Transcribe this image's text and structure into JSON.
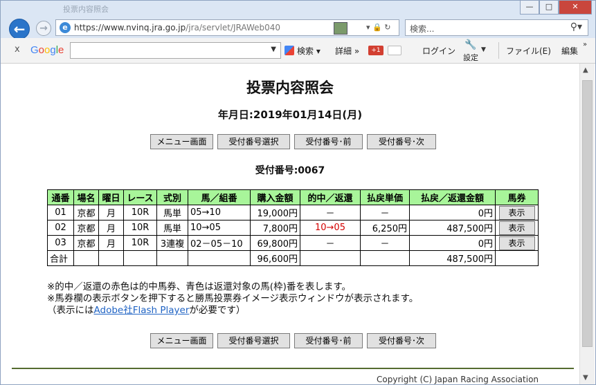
{
  "browser": {
    "title_faded": "投票内容照会",
    "url_prefix": "https://www.nvinq.jra.go.jp",
    "url_path": "/jra/servlet/JRAWeb040",
    "search_placeholder": "検索...",
    "window_controls": {
      "min": "—",
      "max": "□",
      "close": "✕"
    },
    "colors": {
      "chrome": "#dbe6f4",
      "back": "#2a74c9",
      "close": "#c9463d"
    }
  },
  "google_toolbar": {
    "close": "x",
    "logo": [
      "G",
      "o",
      "o",
      "g",
      "l",
      "e"
    ],
    "search_label": "検索",
    "detail_label": "詳細 »",
    "plus_label": "+1",
    "login_label": "ログイン",
    "settings_label": "設定",
    "menu_file": "ファイル(E)",
    "menu_edit": "編集"
  },
  "page": {
    "title": "投票内容照会",
    "date_label": "年月日:2019年01月14日(月)",
    "buttons": {
      "menu": "メニュー画面",
      "select": "受付番号選択",
      "prev": "受付番号･前",
      "next": "受付番号･次"
    },
    "receipt_label": "受付番号:0067",
    "table": {
      "headers": [
        "通番",
        "場名",
        "曜日",
        "レース",
        "式別",
        "馬／組番",
        "購入金額",
        "的中／返還",
        "払戻単価",
        "払戻／返還金額",
        "馬券"
      ],
      "rows": [
        {
          "no": "01",
          "venue": "京都",
          "day": "月",
          "race": "10R",
          "type": "馬単",
          "combo": "05→10",
          "amount": "19,000円",
          "hit": "－",
          "unit": "－",
          "payout": "0円",
          "ticket": "表示"
        },
        {
          "no": "02",
          "venue": "京都",
          "day": "月",
          "race": "10R",
          "type": "馬単",
          "combo": "10→05",
          "amount": "7,800円",
          "hit": "10→05",
          "unit": "6,250円",
          "payout": "487,500円",
          "ticket": "表示"
        },
        {
          "no": "03",
          "venue": "京都",
          "day": "月",
          "race": "10R",
          "type": "3連複",
          "combo": "02－05－10",
          "amount": "69,800円",
          "hit": "－",
          "unit": "－",
          "payout": "0円",
          "ticket": "表示"
        }
      ],
      "total": {
        "label": "合計",
        "amount": "96,600円",
        "payout": "487,500円"
      },
      "colors": {
        "header_bg": "#a8f59a",
        "hit_text": "#d40000"
      }
    },
    "notes": {
      "line1": "※的中／返還の赤色は的中馬券、青色は返還対象の馬(枠)番を表します。",
      "line2": "※馬券欄の表示ボタンを押下すると勝馬投票券イメージ表示ウィンドウが表示されます。",
      "line3_prefix": "（表示には",
      "line3_link": "Adobe社Flash Player",
      "line3_suffix": "が必要です）"
    },
    "copyright": "Copyright (C) Japan Racing Association"
  }
}
